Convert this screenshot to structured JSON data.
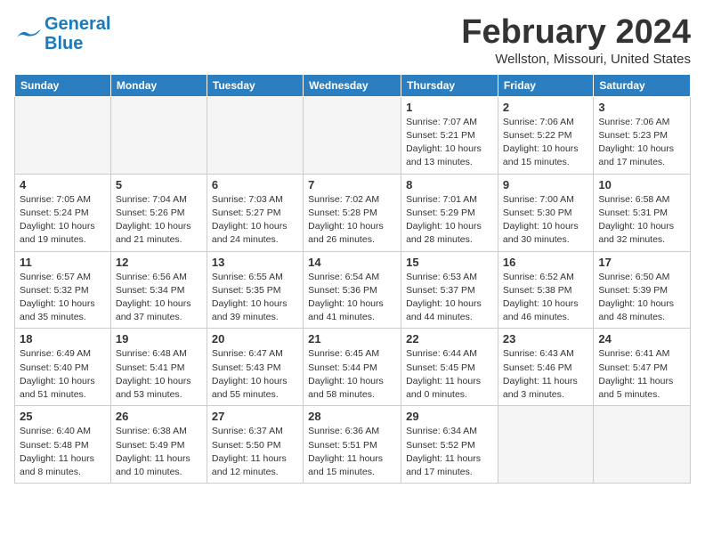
{
  "header": {
    "logo_line1": "General",
    "logo_line2": "Blue",
    "month_title": "February 2024",
    "location": "Wellston, Missouri, United States"
  },
  "weekdays": [
    "Sunday",
    "Monday",
    "Tuesday",
    "Wednesday",
    "Thursday",
    "Friday",
    "Saturday"
  ],
  "weeks": [
    [
      {
        "day": "",
        "info": ""
      },
      {
        "day": "",
        "info": ""
      },
      {
        "day": "",
        "info": ""
      },
      {
        "day": "",
        "info": ""
      },
      {
        "day": "1",
        "info": "Sunrise: 7:07 AM\nSunset: 5:21 PM\nDaylight: 10 hours\nand 13 minutes."
      },
      {
        "day": "2",
        "info": "Sunrise: 7:06 AM\nSunset: 5:22 PM\nDaylight: 10 hours\nand 15 minutes."
      },
      {
        "day": "3",
        "info": "Sunrise: 7:06 AM\nSunset: 5:23 PM\nDaylight: 10 hours\nand 17 minutes."
      }
    ],
    [
      {
        "day": "4",
        "info": "Sunrise: 7:05 AM\nSunset: 5:24 PM\nDaylight: 10 hours\nand 19 minutes."
      },
      {
        "day": "5",
        "info": "Sunrise: 7:04 AM\nSunset: 5:26 PM\nDaylight: 10 hours\nand 21 minutes."
      },
      {
        "day": "6",
        "info": "Sunrise: 7:03 AM\nSunset: 5:27 PM\nDaylight: 10 hours\nand 24 minutes."
      },
      {
        "day": "7",
        "info": "Sunrise: 7:02 AM\nSunset: 5:28 PM\nDaylight: 10 hours\nand 26 minutes."
      },
      {
        "day": "8",
        "info": "Sunrise: 7:01 AM\nSunset: 5:29 PM\nDaylight: 10 hours\nand 28 minutes."
      },
      {
        "day": "9",
        "info": "Sunrise: 7:00 AM\nSunset: 5:30 PM\nDaylight: 10 hours\nand 30 minutes."
      },
      {
        "day": "10",
        "info": "Sunrise: 6:58 AM\nSunset: 5:31 PM\nDaylight: 10 hours\nand 32 minutes."
      }
    ],
    [
      {
        "day": "11",
        "info": "Sunrise: 6:57 AM\nSunset: 5:32 PM\nDaylight: 10 hours\nand 35 minutes."
      },
      {
        "day": "12",
        "info": "Sunrise: 6:56 AM\nSunset: 5:34 PM\nDaylight: 10 hours\nand 37 minutes."
      },
      {
        "day": "13",
        "info": "Sunrise: 6:55 AM\nSunset: 5:35 PM\nDaylight: 10 hours\nand 39 minutes."
      },
      {
        "day": "14",
        "info": "Sunrise: 6:54 AM\nSunset: 5:36 PM\nDaylight: 10 hours\nand 41 minutes."
      },
      {
        "day": "15",
        "info": "Sunrise: 6:53 AM\nSunset: 5:37 PM\nDaylight: 10 hours\nand 44 minutes."
      },
      {
        "day": "16",
        "info": "Sunrise: 6:52 AM\nSunset: 5:38 PM\nDaylight: 10 hours\nand 46 minutes."
      },
      {
        "day": "17",
        "info": "Sunrise: 6:50 AM\nSunset: 5:39 PM\nDaylight: 10 hours\nand 48 minutes."
      }
    ],
    [
      {
        "day": "18",
        "info": "Sunrise: 6:49 AM\nSunset: 5:40 PM\nDaylight: 10 hours\nand 51 minutes."
      },
      {
        "day": "19",
        "info": "Sunrise: 6:48 AM\nSunset: 5:41 PM\nDaylight: 10 hours\nand 53 minutes."
      },
      {
        "day": "20",
        "info": "Sunrise: 6:47 AM\nSunset: 5:43 PM\nDaylight: 10 hours\nand 55 minutes."
      },
      {
        "day": "21",
        "info": "Sunrise: 6:45 AM\nSunset: 5:44 PM\nDaylight: 10 hours\nand 58 minutes."
      },
      {
        "day": "22",
        "info": "Sunrise: 6:44 AM\nSunset: 5:45 PM\nDaylight: 11 hours\nand 0 minutes."
      },
      {
        "day": "23",
        "info": "Sunrise: 6:43 AM\nSunset: 5:46 PM\nDaylight: 11 hours\nand 3 minutes."
      },
      {
        "day": "24",
        "info": "Sunrise: 6:41 AM\nSunset: 5:47 PM\nDaylight: 11 hours\nand 5 minutes."
      }
    ],
    [
      {
        "day": "25",
        "info": "Sunrise: 6:40 AM\nSunset: 5:48 PM\nDaylight: 11 hours\nand 8 minutes."
      },
      {
        "day": "26",
        "info": "Sunrise: 6:38 AM\nSunset: 5:49 PM\nDaylight: 11 hours\nand 10 minutes."
      },
      {
        "day": "27",
        "info": "Sunrise: 6:37 AM\nSunset: 5:50 PM\nDaylight: 11 hours\nand 12 minutes."
      },
      {
        "day": "28",
        "info": "Sunrise: 6:36 AM\nSunset: 5:51 PM\nDaylight: 11 hours\nand 15 minutes."
      },
      {
        "day": "29",
        "info": "Sunrise: 6:34 AM\nSunset: 5:52 PM\nDaylight: 11 hours\nand 17 minutes."
      },
      {
        "day": "",
        "info": ""
      },
      {
        "day": "",
        "info": ""
      }
    ]
  ]
}
